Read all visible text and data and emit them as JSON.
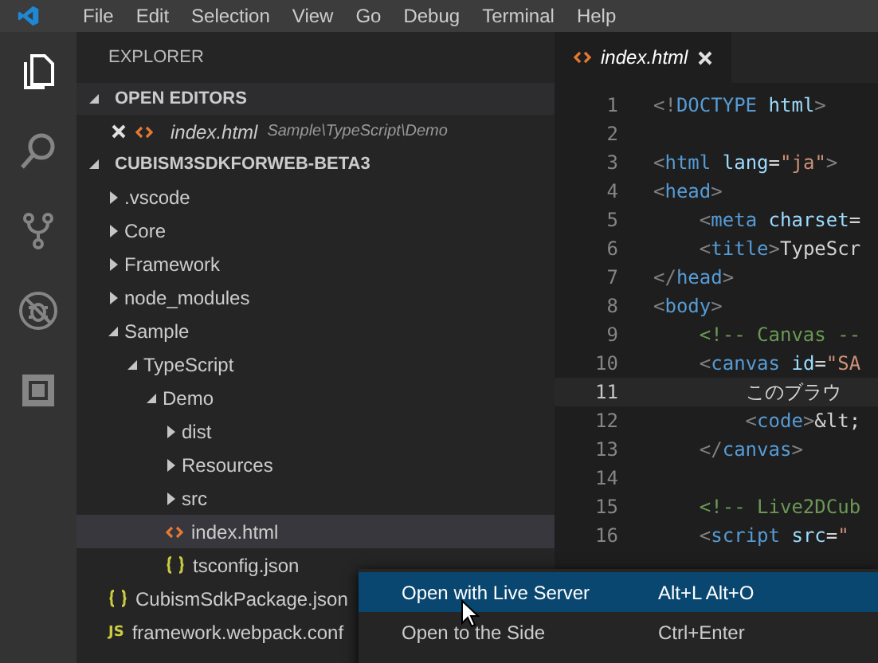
{
  "menu_bar": {
    "items": [
      "File",
      "Edit",
      "Selection",
      "View",
      "Go",
      "Debug",
      "Terminal",
      "Help"
    ]
  },
  "activity_bar": {
    "items": [
      {
        "kind": "files",
        "selected": true
      },
      {
        "kind": "search",
        "selected": false
      },
      {
        "kind": "source_control",
        "selected": false
      },
      {
        "kind": "debug",
        "selected": false
      },
      {
        "kind": "extensions",
        "selected": false
      }
    ]
  },
  "sidebar": {
    "title": "EXPLORER",
    "open_editors": {
      "title": "OPEN EDITORS",
      "expanded": true,
      "items": [
        {
          "name": "index.html",
          "path": "Sample\\TypeScript\\Demo",
          "kind": "html_file"
        }
      ]
    },
    "project": {
      "title": "CUBISM3SDKFORWEB-BETA3",
      "expanded": true,
      "tree": [
        {
          "name": ".vscode",
          "kind": "folder",
          "expanded": false,
          "selected": false
        },
        {
          "name": "Core",
          "kind": "folder",
          "expanded": false,
          "selected": false
        },
        {
          "name": "Framework",
          "kind": "folder",
          "expanded": false,
          "selected": false
        },
        {
          "name": "node_modules",
          "kind": "folder",
          "expanded": false,
          "selected": false
        },
        {
          "name": "Sample",
          "kind": "folder",
          "expanded": true,
          "selected": false,
          "children": [
            {
              "name": "TypeScript",
              "kind": "folder",
              "expanded": true,
              "selected": false,
              "children": [
                {
                  "name": "Demo",
                  "kind": "folder",
                  "expanded": true,
                  "selected": false,
                  "children": [
                    {
                      "name": "dist",
                      "kind": "folder",
                      "expanded": false,
                      "selected": false
                    },
                    {
                      "name": "Resources",
                      "kind": "folder",
                      "expanded": false,
                      "selected": false
                    },
                    {
                      "name": "src",
                      "kind": "folder",
                      "expanded": false,
                      "selected": false
                    },
                    {
                      "name": "index.html",
                      "kind": "html_file",
                      "selected": true
                    },
                    {
                      "name": "tsconfig.json",
                      "kind": "json_file",
                      "selected": false
                    }
                  ]
                }
              ]
            }
          ]
        },
        {
          "name": "CubismSdkPackage.json",
          "kind": "json_file",
          "selected": false
        },
        {
          "name": "framework.webpack.conf",
          "kind": "js_file",
          "icon_label": "JS",
          "selected": false
        }
      ]
    }
  },
  "editor": {
    "tab": {
      "label": "index.html",
      "kind": "html_file"
    },
    "lines": [
      {
        "number": "1",
        "active": false,
        "code": "<!DOCTYPE html>"
      },
      {
        "number": "2",
        "active": false
      },
      {
        "number": "3",
        "active": false,
        "code": "<html lang=\"ja\">"
      },
      {
        "number": "4",
        "active": false,
        "code": "<head>"
      },
      {
        "number": "5",
        "active": false,
        "code": "    <meta charset="
      },
      {
        "number": "6",
        "active": false,
        "code": "    <title>TypeScr"
      },
      {
        "number": "7",
        "active": false,
        "code": "</head>"
      },
      {
        "number": "8",
        "active": false,
        "code": "<body>"
      },
      {
        "number": "9",
        "active": false,
        "code": "    <!-- Canvas --"
      },
      {
        "number": "10",
        "active": false,
        "code": "    <canvas id=\"SA"
      },
      {
        "number": "11",
        "active": true,
        "code": "        このブラウ"
      },
      {
        "number": "12",
        "active": false,
        "code": "        <code>&lt;"
      },
      {
        "number": "13",
        "active": false,
        "code": "    </canvas>"
      },
      {
        "number": "14",
        "active": false
      },
      {
        "number": "15",
        "active": false,
        "code": "    <!-- Live2DCub"
      },
      {
        "number": "16",
        "active": false,
        "code": "    <script src=\""
      }
    ]
  },
  "context_menu": {
    "items": [
      {
        "label": "Open with Live Server",
        "shortcut": "Alt+L Alt+O",
        "selected": true
      },
      {
        "label": "Open to the Side",
        "shortcut": "Ctrl+Enter",
        "selected": false
      }
    ]
  }
}
